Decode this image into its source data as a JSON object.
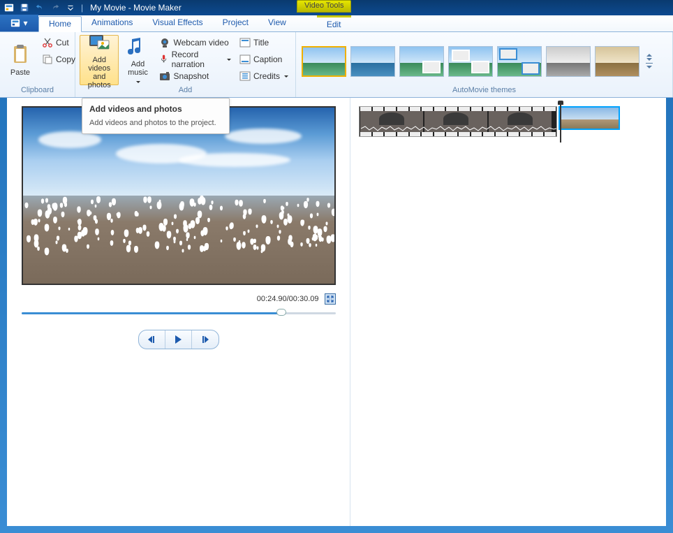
{
  "title_bar": {
    "title": "My Movie - Movie Maker",
    "video_tools": "Video Tools"
  },
  "ribbon_tabs": {
    "home": "Home",
    "animations": "Animations",
    "visual_effects": "Visual Effects",
    "project": "Project",
    "view": "View",
    "edit": "Edit"
  },
  "clipboard": {
    "group": "Clipboard",
    "paste": "Paste",
    "cut": "Cut",
    "copy": "Copy"
  },
  "add": {
    "group": "Add",
    "add_videos_line1": "Add videos",
    "add_videos_line2": "and photos",
    "add_music_line1": "Add",
    "add_music_line2": "music",
    "webcam": "Webcam video",
    "record_narration": "Record narration",
    "snapshot": "Snapshot",
    "title": "Title",
    "caption": "Caption",
    "credits": "Credits"
  },
  "themes": {
    "group": "AutoMovie themes"
  },
  "preview": {
    "time": "00:24.90/00:30.09",
    "seek_percent": 82.7
  },
  "tooltip": {
    "title": "Add videos and photos",
    "body": "Add videos and photos to the project."
  }
}
